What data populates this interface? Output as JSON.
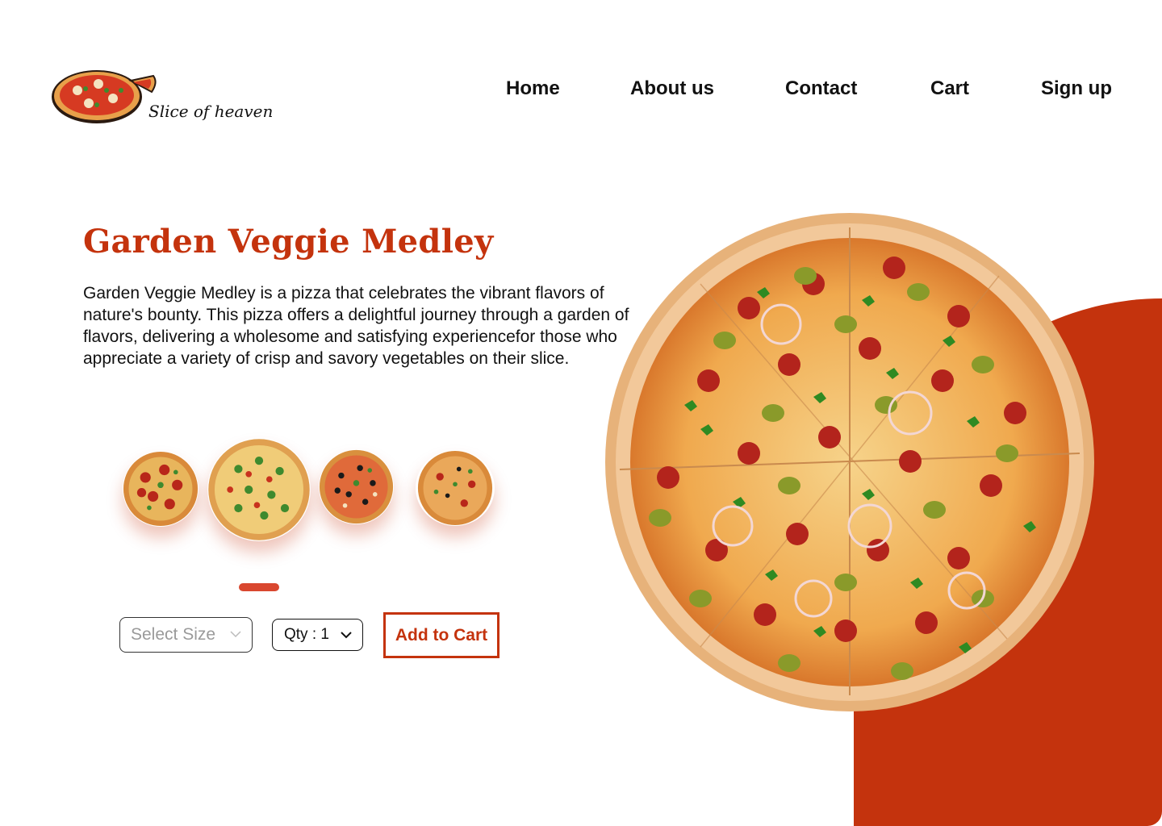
{
  "brand": {
    "name": "Slice of heaven",
    "logo_icon": "pizza-logo-icon"
  },
  "nav": {
    "items": [
      {
        "label": "Home"
      },
      {
        "label": "About us"
      },
      {
        "label": "Contact"
      },
      {
        "label": "Cart"
      },
      {
        "label": "Sign up"
      }
    ]
  },
  "product": {
    "title": "Garden Veggie Medley",
    "description": "Garden Veggie Medley is a pizza that celebrates the vibrant flavors of nature's bounty. This pizza offers a delightful journey through a garden of flavors, delivering a wholesome and satisfying experiencefor those who appreciate a variety of crisp and savory vegetables on their slice."
  },
  "gallery": {
    "thumbnails": [
      {
        "name": "pepperoni-pizza-thumb",
        "selected": false
      },
      {
        "name": "garden-veggie-pizza-thumb",
        "selected": true
      },
      {
        "name": "olive-pizza-thumb",
        "selected": false
      },
      {
        "name": "mixed-pizza-thumb",
        "selected": false
      }
    ],
    "active_index": 1
  },
  "controls": {
    "size_placeholder": "Select Size",
    "qty_label": "Qty : 1",
    "add_to_cart": "Add to Cart"
  },
  "colors": {
    "accent": "#c4330d",
    "indicator": "#d9472f",
    "text": "#111111",
    "placeholder": "#9a9a9a"
  }
}
